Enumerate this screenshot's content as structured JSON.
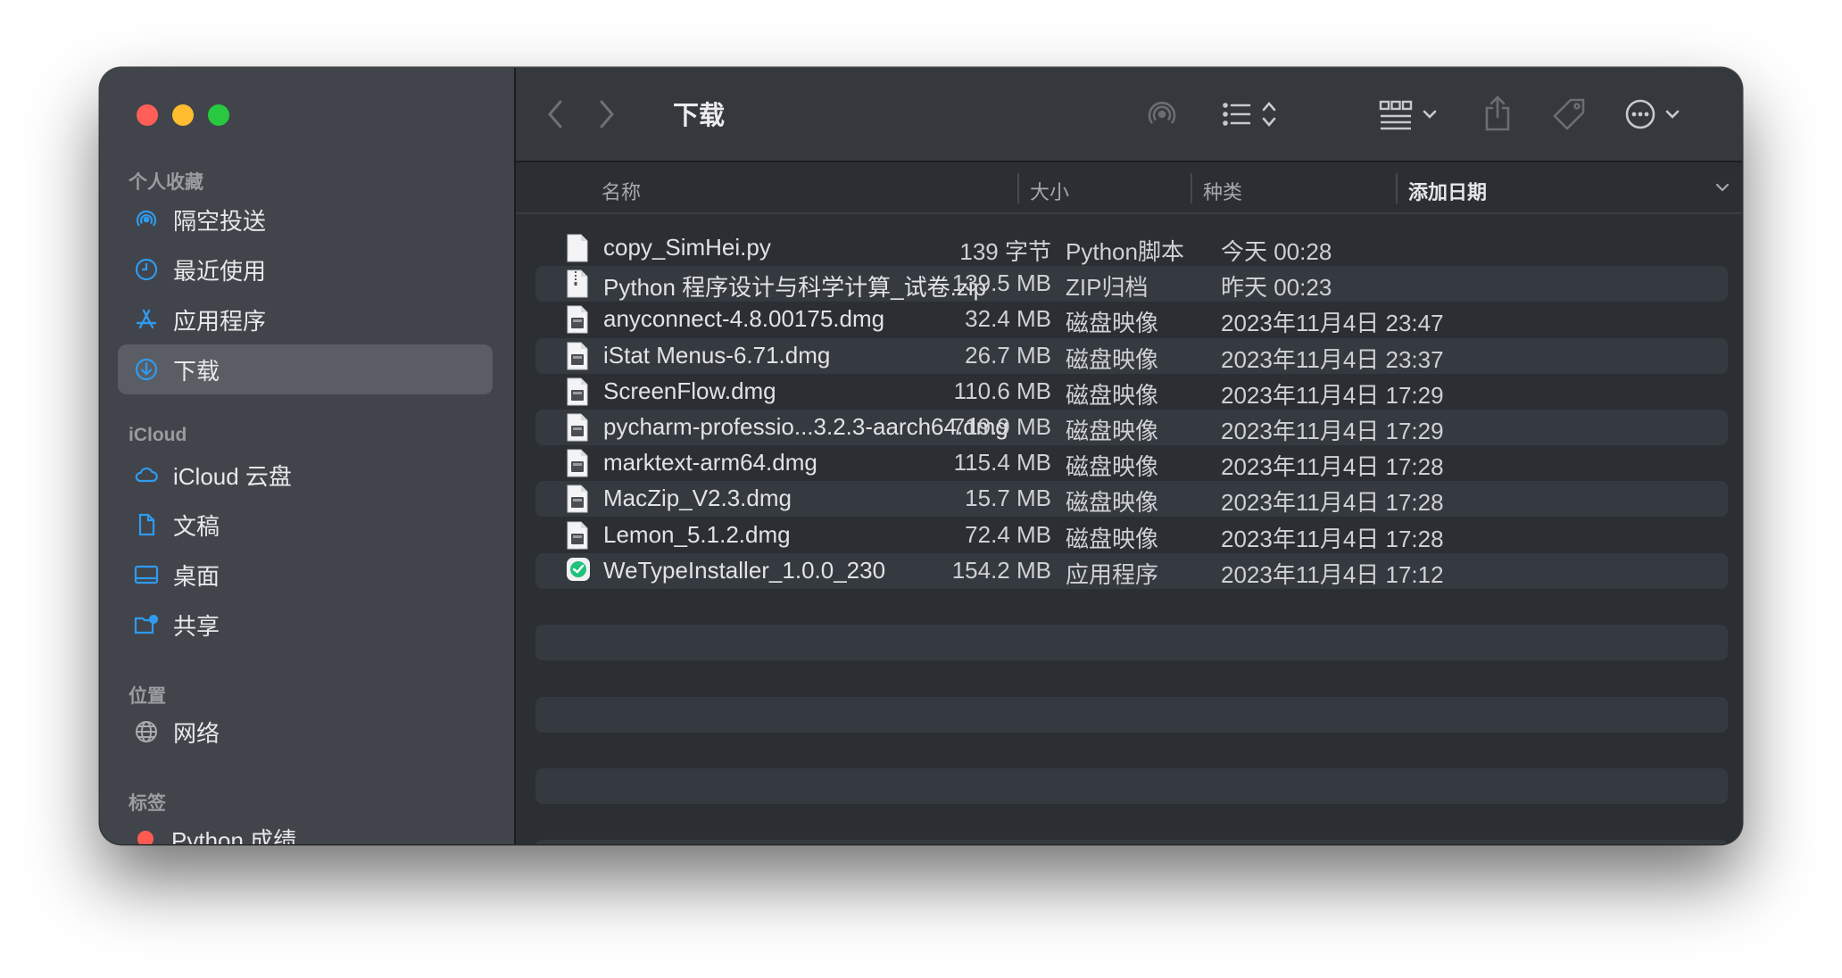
{
  "window": {
    "title": "下载"
  },
  "sidebar": {
    "sections": [
      {
        "header": "个人收藏",
        "items": [
          {
            "label": "隔空投送",
            "icon": "airdrop-icon"
          },
          {
            "label": "最近使用",
            "icon": "clock-icon"
          },
          {
            "label": "应用程序",
            "icon": "applications-icon"
          },
          {
            "label": "下载",
            "icon": "download-icon",
            "active": true
          }
        ]
      },
      {
        "header": "iCloud",
        "items": [
          {
            "label": "iCloud 云盘",
            "icon": "cloud-icon"
          },
          {
            "label": "文稿",
            "icon": "document-icon"
          },
          {
            "label": "桌面",
            "icon": "desktop-icon"
          },
          {
            "label": "共享",
            "icon": "shared-folder-icon"
          }
        ]
      },
      {
        "header": "位置",
        "items": [
          {
            "label": "网络",
            "icon": "network-globe-icon"
          }
        ]
      },
      {
        "header": "标签",
        "items": [
          {
            "label": "Python 成绩",
            "icon": "red-tag-dot",
            "color": "#ff5b52"
          }
        ]
      }
    ]
  },
  "columns": {
    "name": "名称",
    "size": "大小",
    "kind": "种类",
    "date_added": "添加日期"
  },
  "files": [
    {
      "name": "copy_SimHei.py",
      "size": "139 字节",
      "kind": "Python脚本",
      "date": "今天 00:28",
      "icon": "text-file-icon"
    },
    {
      "name": "Python 程序设计与科学计算_试卷.zip",
      "size": "139.5 MB",
      "kind": "ZIP归档",
      "date": "昨天 00:23",
      "icon": "zip-file-icon"
    },
    {
      "name": "anyconnect-4.8.00175.dmg",
      "size": "32.4 MB",
      "kind": "磁盘映像",
      "date": "2023年11月4日 23:47",
      "icon": "disk-image-icon"
    },
    {
      "name": "iStat Menus-6.71.dmg",
      "size": "26.7 MB",
      "kind": "磁盘映像",
      "date": "2023年11月4日 23:37",
      "icon": "disk-image-icon"
    },
    {
      "name": "ScreenFlow.dmg",
      "size": "110.6 MB",
      "kind": "磁盘映像",
      "date": "2023年11月4日 17:29",
      "icon": "disk-image-icon"
    },
    {
      "name": "pycharm-professio...3.2.3-aarch64.dmg",
      "size": "719.9 MB",
      "kind": "磁盘映像",
      "date": "2023年11月4日 17:29",
      "icon": "disk-image-icon"
    },
    {
      "name": "marktext-arm64.dmg",
      "size": "115.4 MB",
      "kind": "磁盘映像",
      "date": "2023年11月4日 17:28",
      "icon": "disk-image-icon"
    },
    {
      "name": "MacZip_V2.3.dmg",
      "size": "15.7 MB",
      "kind": "磁盘映像",
      "date": "2023年11月4日 17:28",
      "icon": "disk-image-icon"
    },
    {
      "name": "Lemon_5.1.2.dmg",
      "size": "72.4 MB",
      "kind": "磁盘映像",
      "date": "2023年11月4日 17:28",
      "icon": "disk-image-icon"
    },
    {
      "name": "WeTypeInstaller_1.0.0_230",
      "size": "154.2 MB",
      "kind": "应用程序",
      "date": "2023年11月4日 17:12",
      "icon": "wetype-app-icon"
    }
  ],
  "colors": {
    "accent": "#2f9bf0",
    "tag_red": "#ff5b52"
  }
}
